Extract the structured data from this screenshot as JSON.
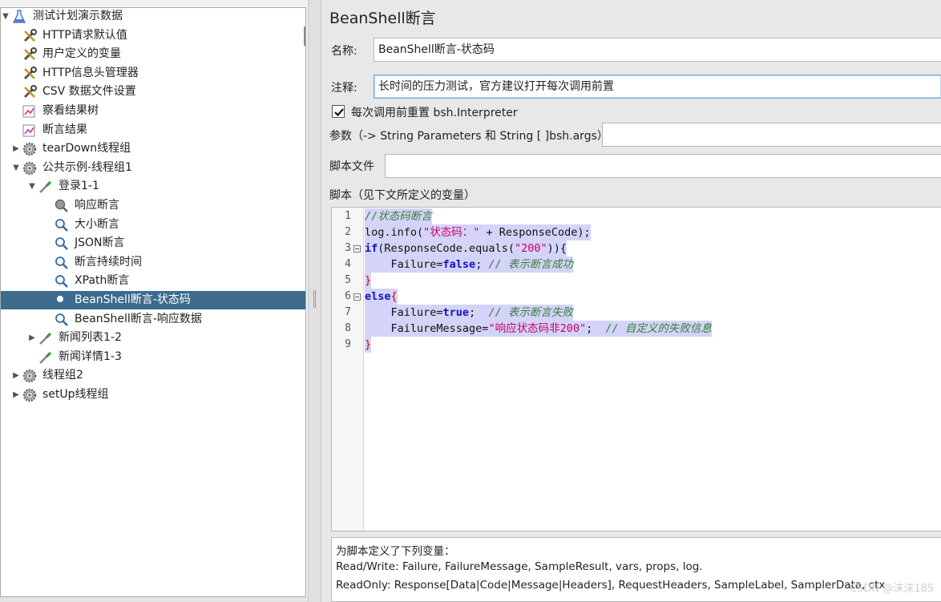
{
  "tree": {
    "items": [
      {
        "label": "测试计划演示数据",
        "icon": "flask-icon",
        "toggle": "expanded"
      },
      {
        "label": "HTTP请求默认值",
        "icon": "wrench-icon",
        "toggle": ""
      },
      {
        "label": "用户定义的变量",
        "icon": "wrench-icon",
        "toggle": ""
      },
      {
        "label": "HTTP信息头管理器",
        "icon": "wrench-icon",
        "toggle": ""
      },
      {
        "label": "CSV 数据文件设置",
        "icon": "wrench-icon",
        "toggle": ""
      },
      {
        "label": "察看结果树",
        "icon": "chart-icon",
        "toggle": ""
      },
      {
        "label": "断言结果",
        "icon": "chart-icon",
        "toggle": ""
      },
      {
        "label": "tearDown线程组",
        "icon": "gear-icon",
        "toggle": "collapsed"
      },
      {
        "label": "公共示例-线程组1",
        "icon": "gear-icon",
        "toggle": "expanded"
      },
      {
        "label": "登录1-1",
        "icon": "pipette-icon",
        "toggle": "expanded"
      },
      {
        "label": "响应断言",
        "icon": "magnifier-gray-icon",
        "toggle": ""
      },
      {
        "label": "大小断言",
        "icon": "magnifier-icon",
        "toggle": ""
      },
      {
        "label": "JSON断言",
        "icon": "magnifier-icon",
        "toggle": ""
      },
      {
        "label": "断言持续时间",
        "icon": "magnifier-icon",
        "toggle": ""
      },
      {
        "label": "XPath断言",
        "icon": "magnifier-icon",
        "toggle": ""
      },
      {
        "label": "BeanShell断言-状态码",
        "icon": "magnifier-icon",
        "toggle": ""
      },
      {
        "label": "BeanShell断言-响应数据",
        "icon": "magnifier-icon",
        "toggle": ""
      },
      {
        "label": "新闻列表1-2",
        "icon": "pipette-icon",
        "toggle": "collapsed"
      },
      {
        "label": "新闻详情1-3",
        "icon": "pipette-icon",
        "toggle": ""
      },
      {
        "label": "线程组2",
        "icon": "gear-icon",
        "toggle": "collapsed"
      },
      {
        "label": "setUp线程组",
        "icon": "gear-icon",
        "toggle": "collapsed"
      }
    ],
    "selected_index": 15
  },
  "editor": {
    "title": "BeanShell断言",
    "name_label": "名称:",
    "name_value": "BeanShell断言-状态码",
    "comment_label": "注释:",
    "comment_value": "长时间的压力测试，官方建议打开每次调用前置",
    "reset_checkbox_label": "每次调用前重置 bsh.Interpreter",
    "reset_checked": true,
    "params_label": "参数（-> String Parameters 和 String [ ]bsh.args）",
    "params_value": "",
    "script_file_label": "脚本文件",
    "script_file_value": "",
    "script_label": "脚本（见下文所定义的变量）"
  },
  "code": {
    "line_numbers": [
      "1",
      "2",
      "3",
      "4",
      "5",
      "6",
      "7",
      "8",
      "9"
    ],
    "lines": [
      [
        {
          "t": "//状态码断言",
          "c": "com"
        }
      ],
      [
        {
          "t": "log.info(",
          "c": ""
        },
        {
          "t": "\"状态码：\"",
          "c": "str"
        },
        {
          "t": " + ResponseCode);",
          "c": ""
        }
      ],
      [
        {
          "t": "if",
          "c": "kw"
        },
        {
          "t": "(ResponseCode.equals(",
          "c": ""
        },
        {
          "t": "\"200\"",
          "c": "str"
        },
        {
          "t": ")){",
          "c": ""
        }
      ],
      [
        {
          "t": "    Failure=",
          "c": ""
        },
        {
          "t": "false",
          "c": "kw"
        },
        {
          "t": "; ",
          "c": ""
        },
        {
          "t": "// 表示断言成功",
          "c": "com"
        }
      ],
      [
        {
          "t": "}",
          "c": "br"
        }
      ],
      [
        {
          "t": "else",
          "c": "kw"
        },
        {
          "t": "{",
          "c": "br"
        }
      ],
      [
        {
          "t": "    Failure=",
          "c": ""
        },
        {
          "t": "true",
          "c": "kw"
        },
        {
          "t": ";  ",
          "c": ""
        },
        {
          "t": "// 表示断言失败",
          "c": "com"
        }
      ],
      [
        {
          "t": "    FailureMessage=",
          "c": ""
        },
        {
          "t": "\"响应状态码非200\"",
          "c": "str"
        },
        {
          "t": ";  ",
          "c": ""
        },
        {
          "t": "// 自定义的失败信息",
          "c": "com"
        }
      ],
      [
        {
          "t": "}",
          "c": "br"
        }
      ]
    ]
  },
  "vars": {
    "heading": "为脚本定义了下列变量：",
    "read_write": "Read/Write: Failure, FailureMessage, SampleResult, vars, props, log.",
    "read_only": "ReadOnly: Response[Data|Code|Message|Headers], RequestHeaders, SampleLabel, SamplerData, ctx"
  },
  "watermark": "CSDN @沫沫18S",
  "colors": {
    "selection": "#3c6b8e",
    "code_highlight": "#d4d4f8",
    "comment": "#3a7d3a",
    "string": "#cc0066",
    "keyword": "#1010c8"
  }
}
